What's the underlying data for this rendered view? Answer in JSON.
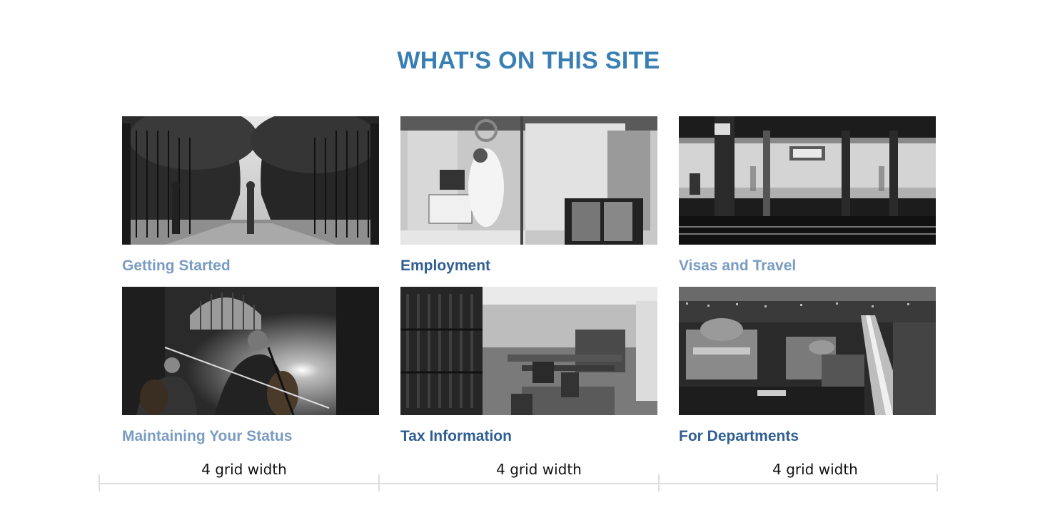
{
  "section": {
    "title": "WHAT'S ON THIS SITE"
  },
  "cards": [
    {
      "label": "Getting Started",
      "image": "campus-gates-photo"
    },
    {
      "label": "Employment",
      "image": "medical-lab-photo"
    },
    {
      "label": "Visas and Travel",
      "image": "subway-platform-photo"
    },
    {
      "label": "Maintaining Your Status",
      "image": "cello-players-photo"
    },
    {
      "label": "Tax Information",
      "image": "library-reading-room-photo"
    },
    {
      "label": "For Departments",
      "image": "campus-aerial-night-photo"
    }
  ],
  "grid_annotation": {
    "labels": [
      "4 grid width",
      "4 grid width",
      "4 grid width"
    ]
  },
  "colors": {
    "title": "#3a7fb3",
    "label_muted": "#7a9cc2",
    "label_strong": "#2f5f93",
    "grid_line": "#dedede"
  }
}
